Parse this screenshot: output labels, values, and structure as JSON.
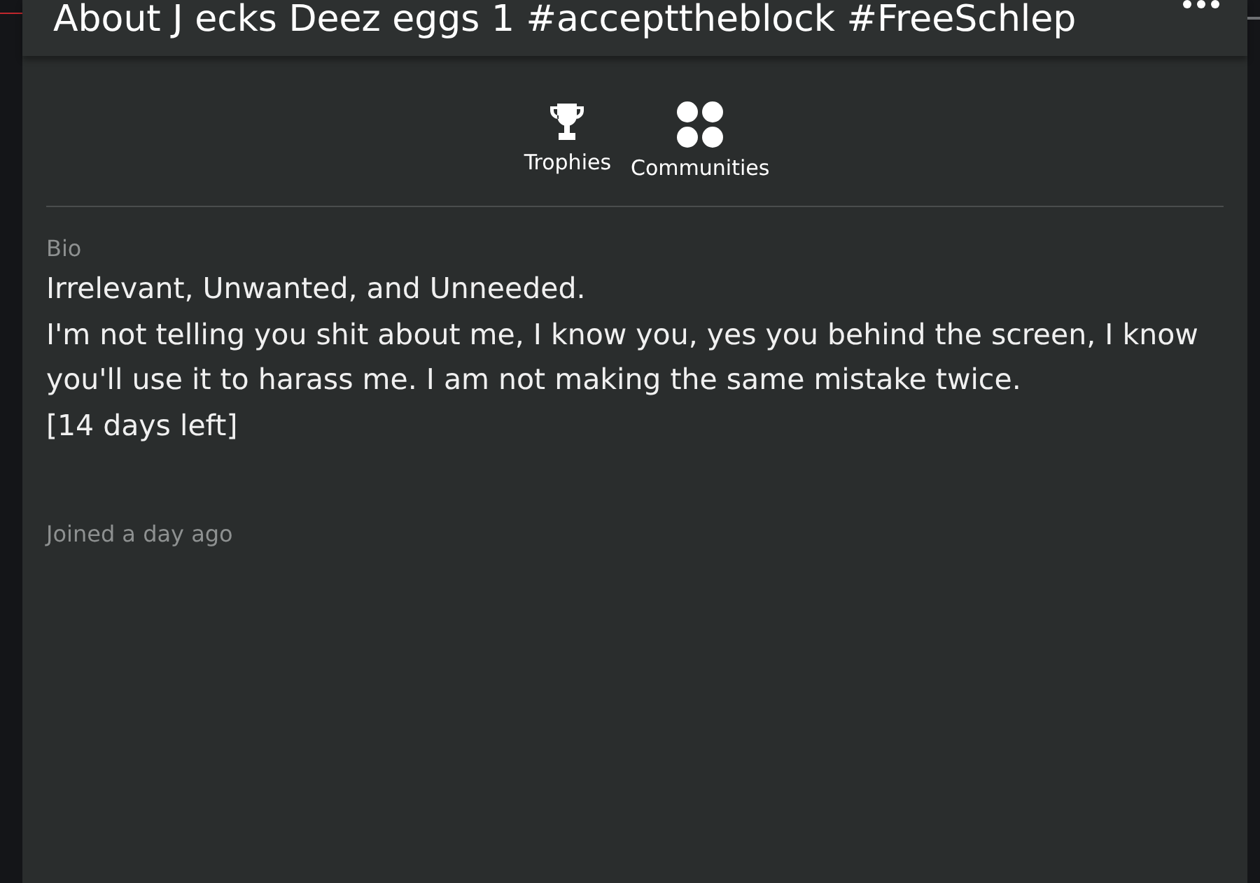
{
  "header": {
    "title": "About J ecks Deez eggs 1 #accepttheblock #FreeSchlep"
  },
  "tabs": [
    {
      "label": "Trophies",
      "kind": "trophy"
    },
    {
      "label": "Communities",
      "kind": "communities"
    }
  ],
  "bio": {
    "label": "Bio",
    "paragraphs": [
      "Irrelevant, Unwanted, and Unneeded.",
      "I'm not telling you shit about me, I know you, yes you behind the screen, I know you'll use it to harass me. I am not making the same mistake twice.",
      "[14 days left]"
    ]
  },
  "joined": "Joined a day ago"
}
